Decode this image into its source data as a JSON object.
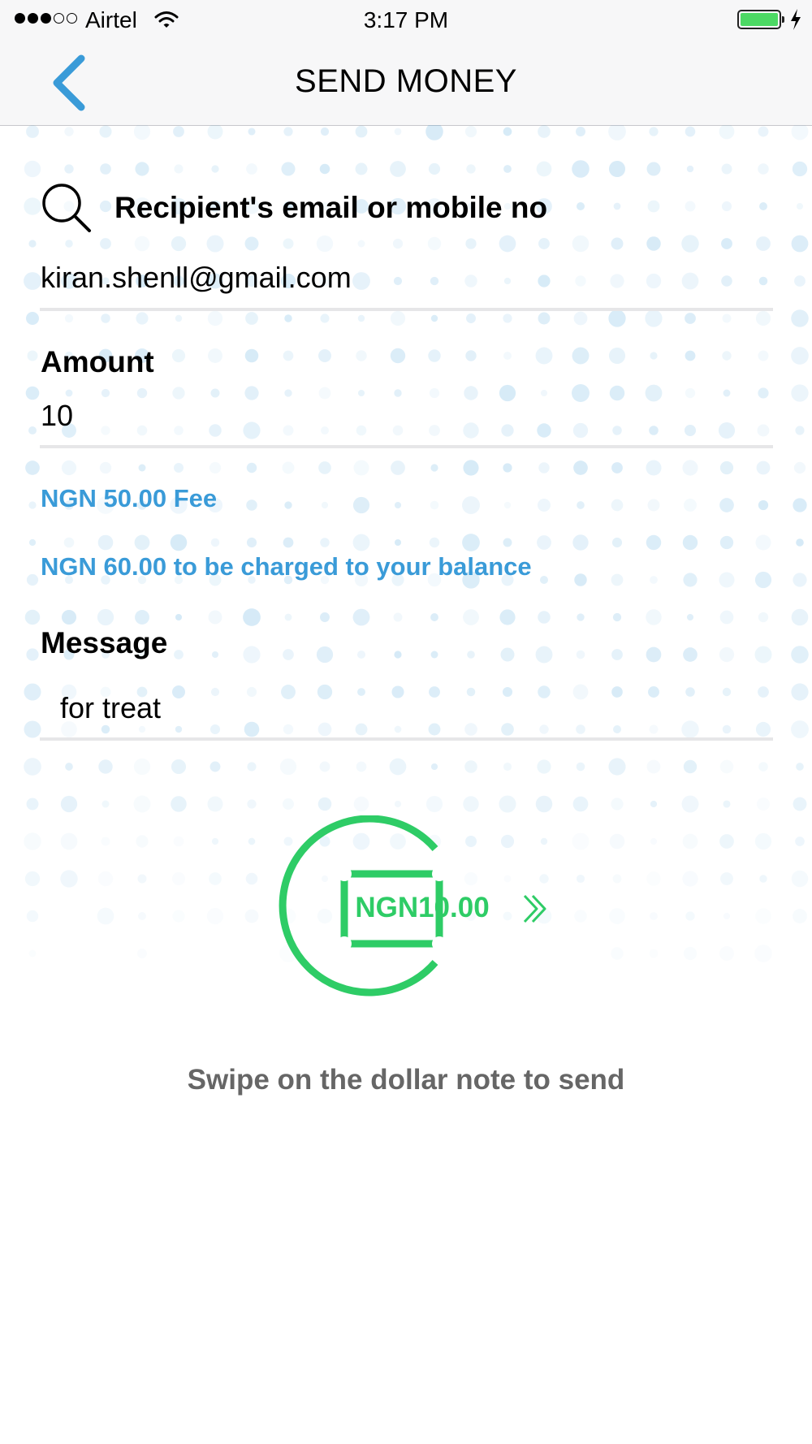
{
  "status_bar": {
    "carrier": "Airtel",
    "time": "3:17 PM",
    "signal_bars_filled": 3,
    "signal_bars_total": 5,
    "battery_level": 1.0
  },
  "nav": {
    "back_icon": "chevron-left-icon",
    "title": "SEND MONEY"
  },
  "form": {
    "search_icon": "search-icon",
    "recipient_label": "Recipient's email or mobile no",
    "recipient_value": "kiran.shenll@gmail.com",
    "amount_label": "Amount",
    "amount_value": "10",
    "fee_text": "NGN 50.00 Fee",
    "charge_text": "NGN 60.00 to be charged to your balance",
    "message_label": "Message",
    "message_value": "for treat"
  },
  "swipe": {
    "note_label": "NGN10.00",
    "arrow_icon": "double-chevron-right-icon",
    "hint": "Swipe on the dollar note to send"
  },
  "colors": {
    "accent_blue": "#3a9bd8",
    "money_green": "#2ecc66",
    "hint_gray": "#666666"
  }
}
